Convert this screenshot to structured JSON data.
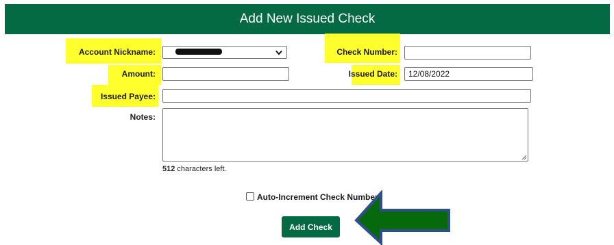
{
  "header": {
    "title": "Add New Issued Check"
  },
  "form": {
    "account_nickname_label": "Account Nickname:",
    "check_number_label": "Check Number:",
    "check_number_value": "",
    "amount_label": "Amount:",
    "amount_value": "",
    "issued_date_label": "Issued Date:",
    "issued_date_value": "12/08/2022",
    "issued_payee_label": "Issued Payee:",
    "issued_payee_value": "",
    "notes_label": "Notes:",
    "notes_value": "",
    "chars_left_count": "512",
    "chars_left_text": " characters left.",
    "auto_increment_label": "Auto-Increment Check Number",
    "auto_increment_checked": false,
    "submit_label": "Add Check"
  },
  "colors": {
    "brand_green": "#046a43",
    "highlight_yellow": "#ffff2e",
    "arrow_fill": "#066a0d",
    "arrow_outline": "#2f4f8a"
  }
}
